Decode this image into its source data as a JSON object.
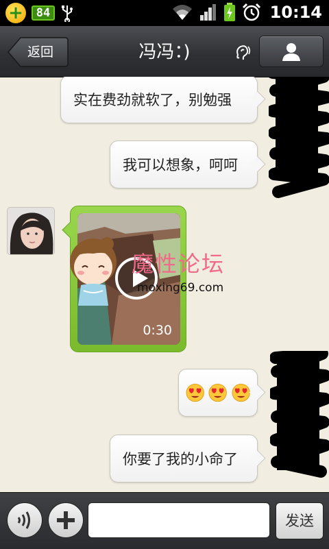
{
  "status_bar": {
    "battery_level": "84",
    "time": "10:14"
  },
  "header": {
    "back_label": "返回",
    "title": "冯冯：)",
    "icons": [
      "earpiece-icon",
      "profile-icon"
    ]
  },
  "messages": [
    {
      "side": "right",
      "type": "text",
      "text": "实在费劲就软了，别勉强"
    },
    {
      "side": "right",
      "type": "text",
      "text": "我可以想象，呵呵"
    },
    {
      "side": "left",
      "type": "video",
      "duration": "0:30"
    },
    {
      "side": "right",
      "type": "emoji",
      "emoji_count": 3,
      "emoji": "heart-eyes-emoji"
    },
    {
      "side": "right",
      "type": "text",
      "text": "你要了我的小命了"
    }
  ],
  "watermark": {
    "text": "魔性论坛",
    "url": "moxing69.com"
  },
  "input_bar": {
    "input_value": "",
    "send_label": "发送",
    "icons": [
      "voice-icon",
      "plus-icon"
    ]
  },
  "colors": {
    "status_bar": "#000000",
    "header": "#2f3134",
    "chat_background": "#f1ede1",
    "video_bubble": "#86c83a",
    "watermark": "#f06a8a"
  }
}
